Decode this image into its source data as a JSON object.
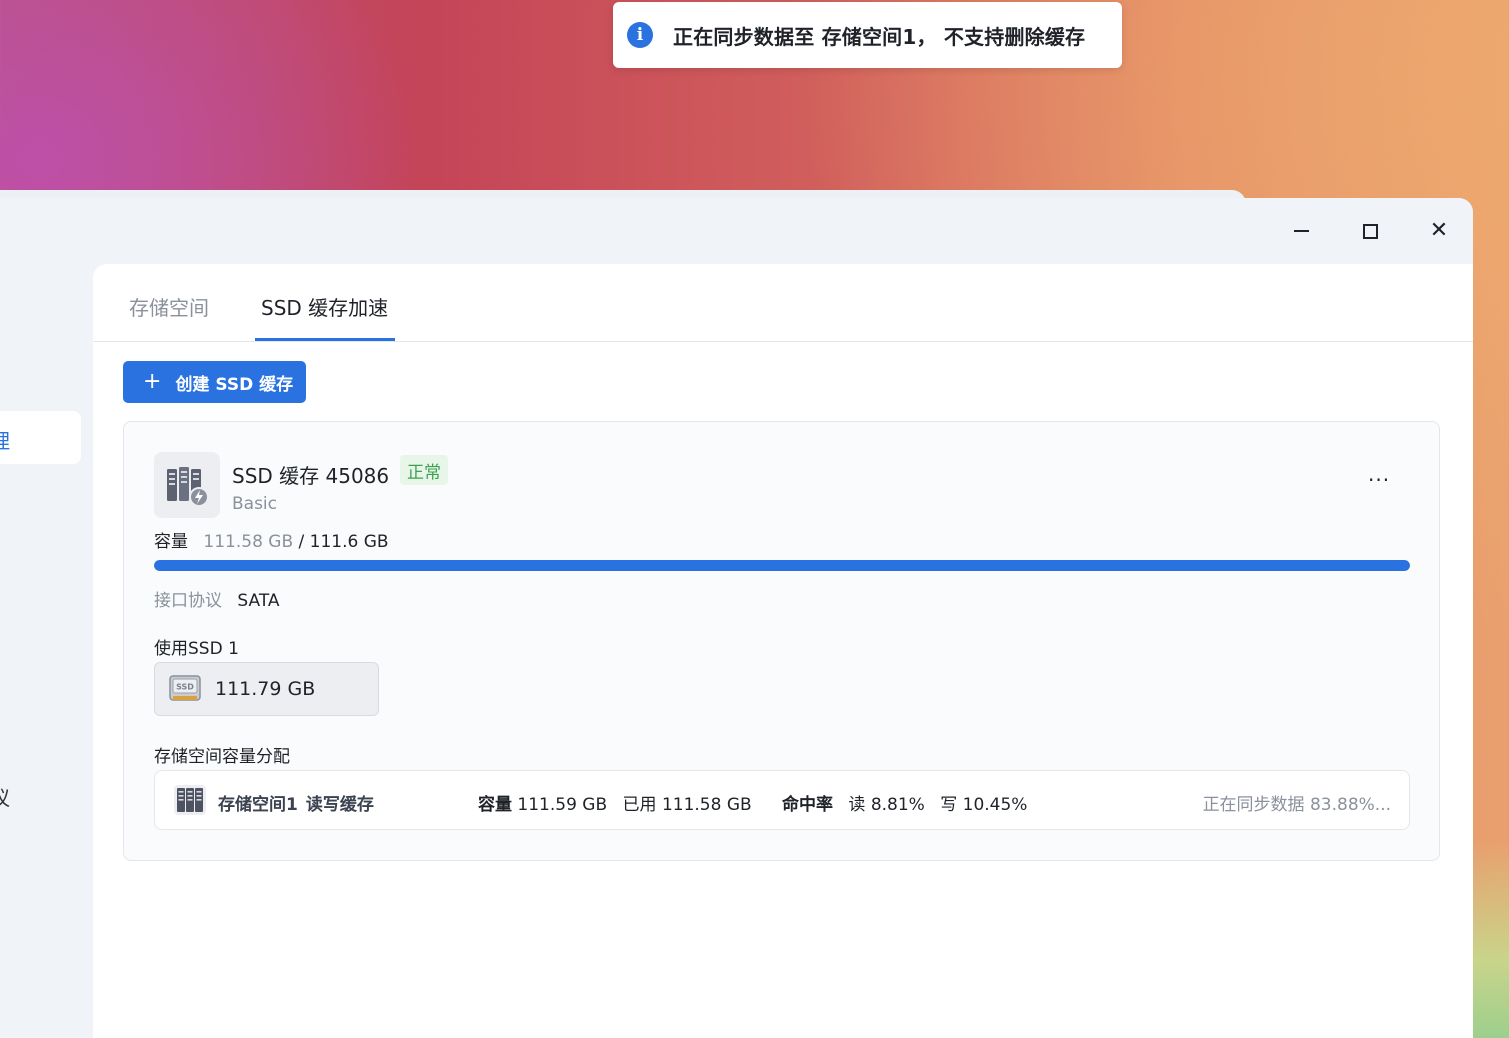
{
  "toast": {
    "icon": "info-icon",
    "message": "正在同步数据至 存储空间1， 不支持删除缓存"
  },
  "sidebar": {
    "active_item_fragment": "理",
    "item_fragment_2": "议"
  },
  "window_controls": {
    "minimize": "minimize-icon",
    "maximize": "maximize-icon",
    "close": "close-icon"
  },
  "tabs": [
    {
      "label": "存储空间",
      "active": false
    },
    {
      "label": "SSD 缓存加速",
      "active": true
    }
  ],
  "toolbar": {
    "create_icon": "plus-icon",
    "create_label": "创建 SSD 缓存"
  },
  "cache": {
    "icon": "ssd-cache-server-icon",
    "title": "SSD 缓存 45086",
    "status": "正常",
    "type": "Basic",
    "more": "···",
    "capacity_label": "容量",
    "capacity_used": "111.58 GB",
    "capacity_total": "/ 111.6 GB",
    "capacity_fraction": 0.9998,
    "interface_label": "接口协议",
    "interface_value": "SATA",
    "used_ssd_label": "使用SSD 1",
    "ssd_icon": "ssd-drive-icon",
    "ssd_size": "111.79 GB",
    "alloc_label": "存储空间容量分配",
    "alloc": {
      "icon": "storage-server-icon",
      "name": "存储空间1",
      "mode": "读写缓存",
      "cap_label": "容量",
      "cap_value": "111.59 GB",
      "used_label": "已用",
      "used_value": "111.58 GB",
      "hit_label": "命中率",
      "read_label": "读",
      "read_value": "8.81%",
      "write_label": "写",
      "write_value": "10.45%",
      "sync_status": "正在同步数据 83.88%..."
    }
  },
  "colors": {
    "accent": "#2a72e0",
    "status_ok": "#3da150"
  }
}
